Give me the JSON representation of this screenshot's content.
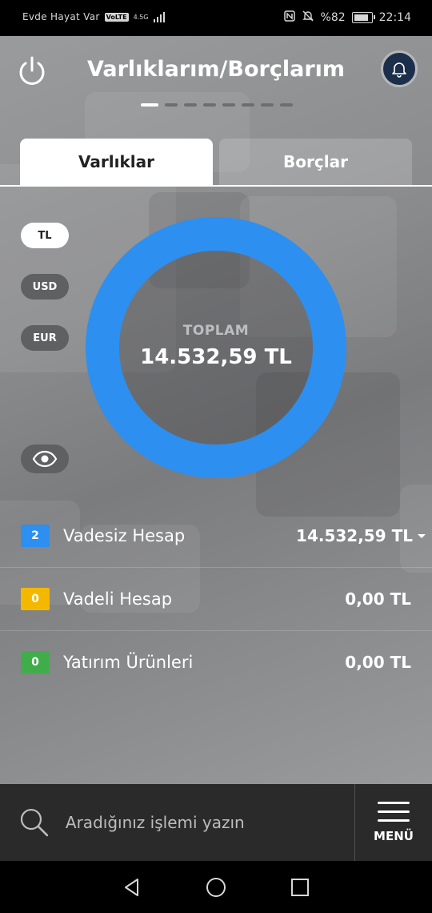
{
  "status_bar": {
    "carrier": "Evde Hayat Var",
    "volte": "VoLTE",
    "network": "4.5G",
    "battery_text": "%82",
    "time": "22:14"
  },
  "header": {
    "title": "Varlıklarım/Borçlarım",
    "page_count": 8,
    "active_page": 0
  },
  "tabs": [
    {
      "label": "Varlıklar",
      "active": true
    },
    {
      "label": "Borçlar",
      "active": false
    }
  ],
  "currency_toggle": [
    {
      "label": "TL",
      "active": true
    },
    {
      "label": "USD",
      "active": false
    },
    {
      "label": "EUR",
      "active": false
    }
  ],
  "summary": {
    "total_label": "TOPLAM",
    "total_value": "14.532,59 TL",
    "ring_color": "#2d8ff0"
  },
  "asset_rows": [
    {
      "count": "2",
      "label": "Vadesiz Hesap",
      "amount": "14.532,59 TL",
      "color": "#2d8ff0",
      "expandable": true
    },
    {
      "count": "0",
      "label": "Vadeli Hesap",
      "amount": "0,00 TL",
      "color": "#f5b800",
      "expandable": false
    },
    {
      "count": "0",
      "label": "Yatırım Ürünleri",
      "amount": "0,00 TL",
      "color": "#3fae4a",
      "expandable": false
    }
  ],
  "bottom_bar": {
    "search_placeholder": "Aradığınız işlemi yazın",
    "menu_label": "MENÜ"
  },
  "icons": {
    "power": "power-icon",
    "bell": "bell-icon",
    "eye": "eye-icon",
    "search": "search-icon",
    "menu": "hamburger-menu-icon",
    "nav_back": "back-triangle-icon",
    "nav_home": "home-circle-icon",
    "nav_recent": "recent-square-icon"
  }
}
